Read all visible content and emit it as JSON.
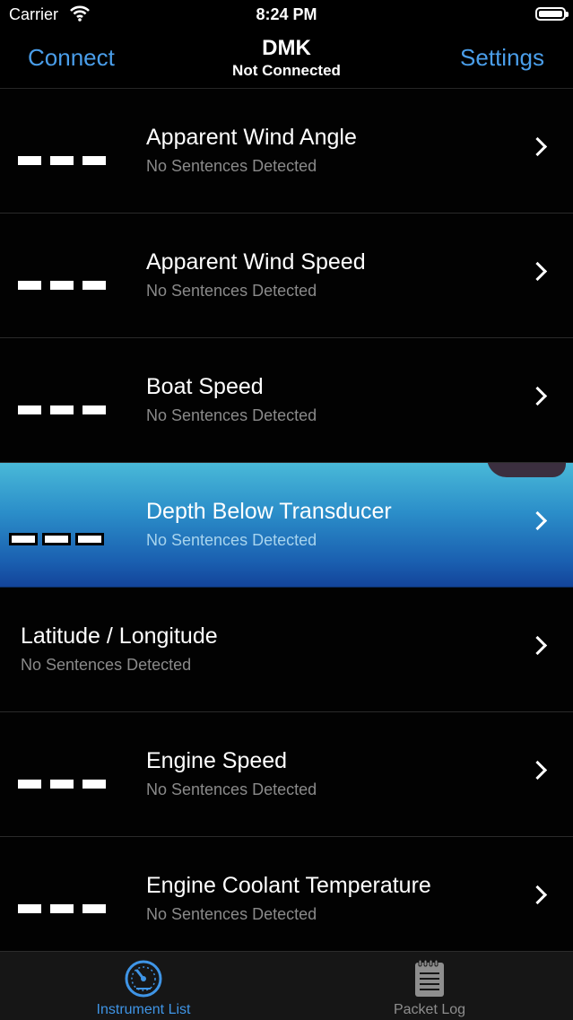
{
  "status_bar": {
    "carrier": "Carrier",
    "time": "8:24 PM"
  },
  "nav": {
    "left": "Connect",
    "title": "DMK",
    "subtitle": "Not Connected",
    "right": "Settings"
  },
  "rows": [
    {
      "title": "Apparent Wind Angle",
      "subtitle": "No Sentences Detected"
    },
    {
      "title": "Apparent Wind Speed",
      "subtitle": "No Sentences Detected"
    },
    {
      "title": "Boat Speed",
      "subtitle": "No Sentences Detected"
    },
    {
      "title": "Depth Below Transducer",
      "subtitle": "No Sentences Detected"
    },
    {
      "title": "Latitude / Longitude",
      "subtitle": "No Sentences Detected"
    },
    {
      "title": "Engine Speed",
      "subtitle": "No Sentences Detected"
    },
    {
      "title": "Engine Coolant Temperature",
      "subtitle": "No Sentences Detected"
    }
  ],
  "tabs": [
    {
      "label": "Instrument List",
      "icon": "gauge-icon",
      "selected": true
    },
    {
      "label": "Packet Log",
      "icon": "notepad-icon",
      "selected": false
    }
  ],
  "colors": {
    "accent": "#4a9eea",
    "background": "#000000",
    "highlight_row": "#2b8ec9"
  }
}
